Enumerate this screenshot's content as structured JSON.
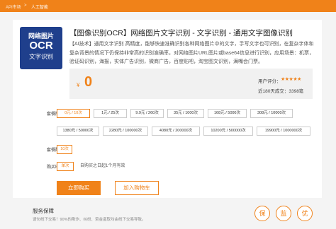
{
  "breadcrumb": {
    "home": "API市场",
    "separator": ">",
    "current": "人工智能"
  },
  "product": {
    "logo_lines": [
      "网络图片",
      "OCR",
      "文字识别"
    ],
    "title": "【图像识别OCR】网络图片文字识别 - 文字识别 - 通用文字图像识别",
    "description": "【AI技术】通用文字识别 高精度，能够快速准确识别各种网络图片中的文字，手写文字也可识别，在复杂字体和复杂背景的情况下仍保持非常高的识别准确率，对网络图片URL图片或base64信息进行识别，应用场景：机票，验证码识别，海报，实体广告识别，微商广告，百度贴吧，淘宝图文识别，满嘴会门票。",
    "price_currency": "¥",
    "price_value": "0",
    "rating_label": "用户评分：",
    "rating_stars": "★★★★★",
    "sales": "近180天成交：3398笔"
  },
  "specs": {
    "package_label": "套餐版本：",
    "package_options": [
      "0元 / 10次",
      "1元 / 25次",
      "9.9元 / 260次",
      "35元 / 1000次",
      "168元 / 5000次",
      "308元 / 10000次",
      "1380元 / 50000次",
      "2280元 / 100000次",
      "4080元 / 200000次",
      "10200元 / 500000次",
      "19900元 / 1000000次"
    ],
    "package_selected": 0,
    "quota_label": "套餐配额：",
    "quota_value": "10次",
    "duration_label": "购买时长：",
    "duration_value": "单次",
    "duration_hint": "自购买之日起1个月有效"
  },
  "actions": {
    "buy": "立即购买",
    "cart": "加入购物车"
  },
  "guarantee": {
    "title": "服务保障",
    "text": "请勿线下交易！90%的欺诈、纠纷、资金盗取均由线下交易导致。",
    "badges": [
      "保",
      "监",
      "优"
    ]
  },
  "colors": {
    "accent": "#f08219",
    "logo_bg": "#1f3f8c"
  }
}
